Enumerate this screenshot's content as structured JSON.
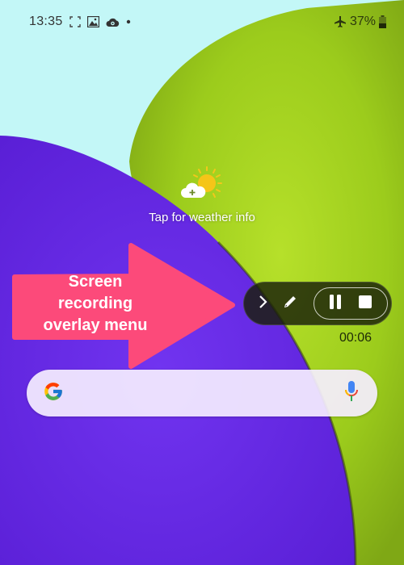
{
  "status_bar": {
    "time": "13:35",
    "left_icons": [
      "screenshot-frame-icon",
      "gallery-icon",
      "cloud-sync-icon",
      "notification-dot-icon"
    ],
    "right_icons": [
      "airplane-mode-icon",
      "battery-icon"
    ],
    "battery_percent": "37%"
  },
  "weather_widget": {
    "icon": "partly-sunny-add-icon",
    "label": "Tap for weather info"
  },
  "annotation": {
    "text_lines": [
      "Screen",
      "recording",
      "overlay menu"
    ],
    "color": "#fc4a7a"
  },
  "recording_toolbar": {
    "expand_icon": "chevron-right-icon",
    "draw_icon": "pencil-icon",
    "pause_icon": "pause-icon",
    "stop_icon": "stop-icon",
    "elapsed": "00:06"
  },
  "search_widget": {
    "logo": "google-g-icon",
    "voice_icon": "microphone-icon"
  },
  "colors": {
    "sky": "#c3f7f7",
    "purple_ball": "#6a2de8",
    "green_ball": "#a8d420"
  }
}
